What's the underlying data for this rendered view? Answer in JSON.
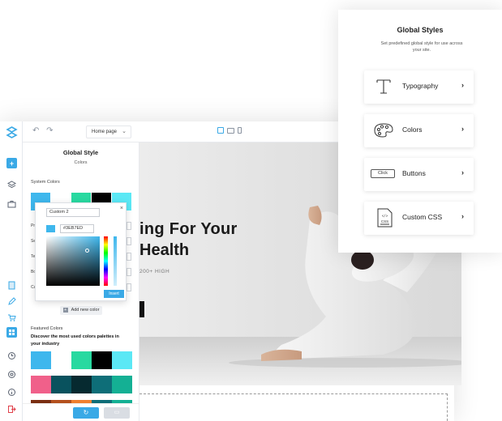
{
  "editor": {
    "toolbar": {
      "undo_redo": "↶ ↷",
      "page_select": "Home page"
    },
    "panel": {
      "title": "Global Style",
      "subtitle": "Colors",
      "system_colors_label": "System Colors",
      "system_swatches": [
        "#3EB7ED",
        "#FFFFFF",
        "#28D9A0",
        "#000000",
        "#5BE8F5"
      ],
      "row_labels": [
        "Pr",
        "Se",
        "Te",
        "Bo",
        "Ca"
      ],
      "add_color": "Add new color",
      "featured_label": "Featured Colors",
      "featured_desc": "Discover the most used colors palettes in your industry",
      "palette_1": [
        "#3EB7ED",
        "#FFFFFF",
        "#28D9A0",
        "#000000",
        "#5BE8F5"
      ],
      "palette_2": [
        "#F0608A",
        "#09525E",
        "#062A30",
        "#0E6E78",
        "#14B094"
      ],
      "palette_3": [
        "#7A2E12",
        "#B4501E",
        "#F08030",
        "#0E6E78",
        "#14B094"
      ],
      "reset_icon": "↻",
      "save_icon": "▭"
    },
    "picker": {
      "name_value": "Custom 2",
      "close": "×",
      "hex_value": "#3EB7ED",
      "insert_label": "Insert"
    },
    "canvas": {
      "hero_line1": "ing For Your",
      "hero_line2": "Health",
      "hero_sub": "200+ HIGH"
    }
  },
  "global_styles": {
    "title": "Global Styles",
    "subtitle": "Set predefined global style for use across your site.",
    "items": [
      {
        "label": "Typography",
        "icon": "typography-icon"
      },
      {
        "label": "Colors",
        "icon": "palette-icon"
      },
      {
        "label": "Buttons",
        "icon": "button-icon",
        "icon_text": "Click"
      },
      {
        "label": "Custom CSS",
        "icon": "css-file-icon",
        "icon_text": "CSS"
      }
    ],
    "arrow": "›"
  },
  "colors": {
    "accent": "#3aa9e6",
    "picker_value": "#3EB7ED"
  }
}
